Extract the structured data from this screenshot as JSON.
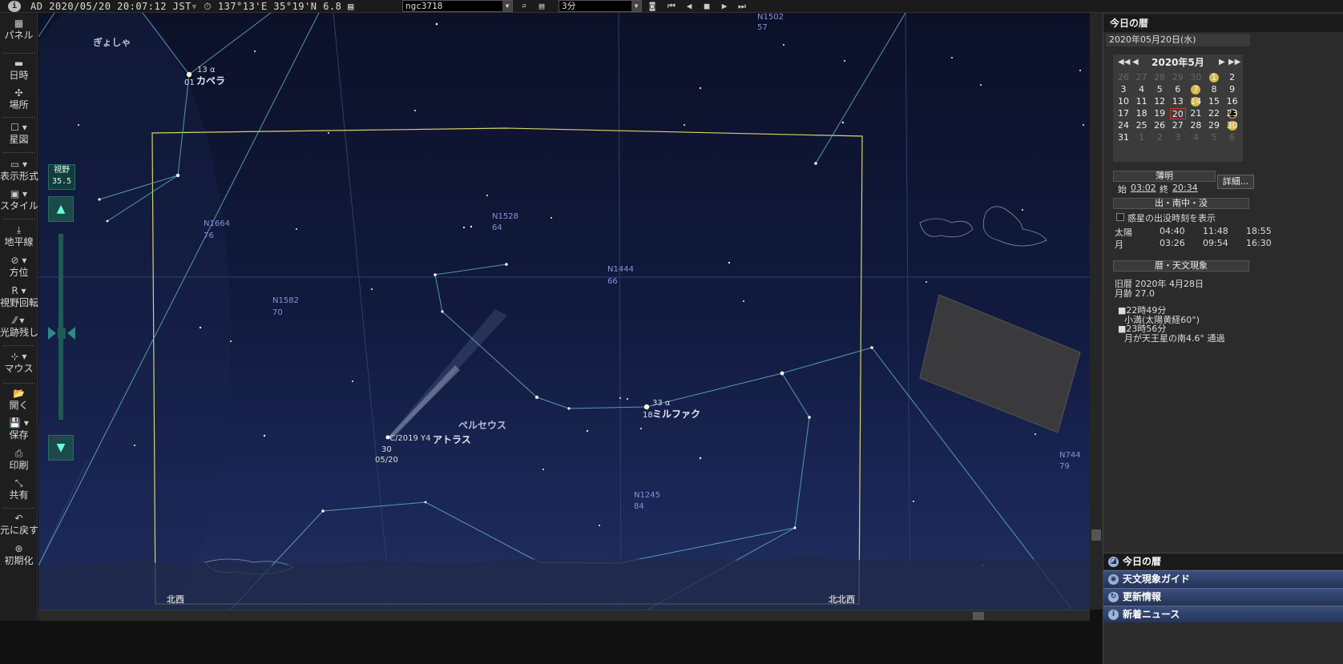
{
  "topbar": {
    "status": "AD 2020/05/20 20:07:12 JST▿ ⏱ 137°13'E 35°19'N  6.8 ▤",
    "object_combo": "ngc3718",
    "step_combo": "3分"
  },
  "left_toolbar": [
    {
      "label": "パネル",
      "icon": "panel-icon"
    },
    {
      "label": "日時",
      "icon": "clock-icon"
    },
    {
      "label": "場所",
      "icon": "location-icon"
    },
    {
      "label": "星図",
      "icon": "star-chart-icon"
    },
    {
      "label": "表示形式",
      "icon": "display-format-icon"
    },
    {
      "label": "スタイル",
      "icon": "style-icon"
    },
    {
      "label": "地平線",
      "icon": "horizon-icon"
    },
    {
      "label": "方位",
      "icon": "compass-icon"
    },
    {
      "label": "視野回転",
      "icon": "rotate-icon"
    },
    {
      "label": "光跡残し",
      "icon": "trail-icon"
    },
    {
      "label": "マウス",
      "icon": "mouse-icon"
    },
    {
      "label": "開く",
      "icon": "open-icon"
    },
    {
      "label": "保存",
      "icon": "save-icon"
    },
    {
      "label": "印刷",
      "icon": "print-icon"
    },
    {
      "label": "共有",
      "icon": "share-icon"
    },
    {
      "label": "元に戻す",
      "icon": "undo-icon"
    },
    {
      "label": "初期化",
      "icon": "reset-icon"
    }
  ],
  "fov": {
    "label": "視野",
    "value": "35.5"
  },
  "sky": {
    "constellations": {
      "auriga": "ぎょしゃ",
      "perseus": "ペルセウス"
    },
    "capella": {
      "id": "13 α",
      "name": "カペラ",
      "mag": "01"
    },
    "mirfak": {
      "id": "33 α",
      "name": "ミルファク",
      "mag": "18"
    },
    "comet": {
      "id": "C/2019 Y4",
      "name": "アトラス",
      "mag": "30",
      "date": "05/20"
    },
    "ngc": [
      {
        "name": "N1502",
        "mag": "57"
      },
      {
        "name": "N1664",
        "mag": "76"
      },
      {
        "name": "N1528",
        "mag": "64"
      },
      {
        "name": "N1444",
        "mag": "66"
      },
      {
        "name": "N1582",
        "mag": "70"
      },
      {
        "name": "N1245",
        "mag": "84"
      },
      {
        "name": "N744",
        "mag": "79"
      }
    ],
    "directions": {
      "nw": "北西",
      "nnw": "北北西"
    }
  },
  "right_panel": {
    "title": "今日の暦",
    "date": "2020年05月20日(水)",
    "calendar": {
      "month": "2020年5月",
      "rows": [
        [
          "26",
          "27",
          "28",
          "29",
          "30",
          "1",
          "2"
        ],
        [
          "3",
          "4",
          "5",
          "6",
          "7",
          "8",
          "9"
        ],
        [
          "10",
          "11",
          "12",
          "13",
          "14",
          "15",
          "16"
        ],
        [
          "17",
          "18",
          "19",
          "20",
          "21",
          "22",
          "23"
        ],
        [
          "24",
          "25",
          "26",
          "27",
          "28",
          "29",
          "30"
        ],
        [
          "31",
          "1",
          "2",
          "3",
          "4",
          "5",
          "6"
        ]
      ],
      "selected": "20"
    },
    "twilight": {
      "title": "薄明",
      "start_label": "始",
      "start": "03:02",
      "end_label": "終",
      "end": "20:34",
      "detail_button": "詳細..."
    },
    "rise_set": {
      "title": "出・南中・没",
      "checkbox_label": "惑星の出没時刻を表示",
      "rows": [
        {
          "body": "太陽",
          "rise": "04:40",
          "transit": "11:48",
          "set": "18:55"
        },
        {
          "body": "月",
          "rise": "03:26",
          "transit": "09:54",
          "set": "16:30"
        }
      ]
    },
    "phenomena": {
      "title": "暦・天文現象",
      "lunar_date": "旧暦 2020年 4月28日",
      "moon_age": "月齢 27.0",
      "events": [
        {
          "time": "■22時49分",
          "desc": "小満(太陽黄経60°)"
        },
        {
          "time": "■23時56分",
          "desc": "月が天王星の南4.6° 通過"
        }
      ]
    },
    "tabs": [
      "今日の暦",
      "天文現象ガイド",
      "更新情報",
      "新着ニュース"
    ]
  }
}
